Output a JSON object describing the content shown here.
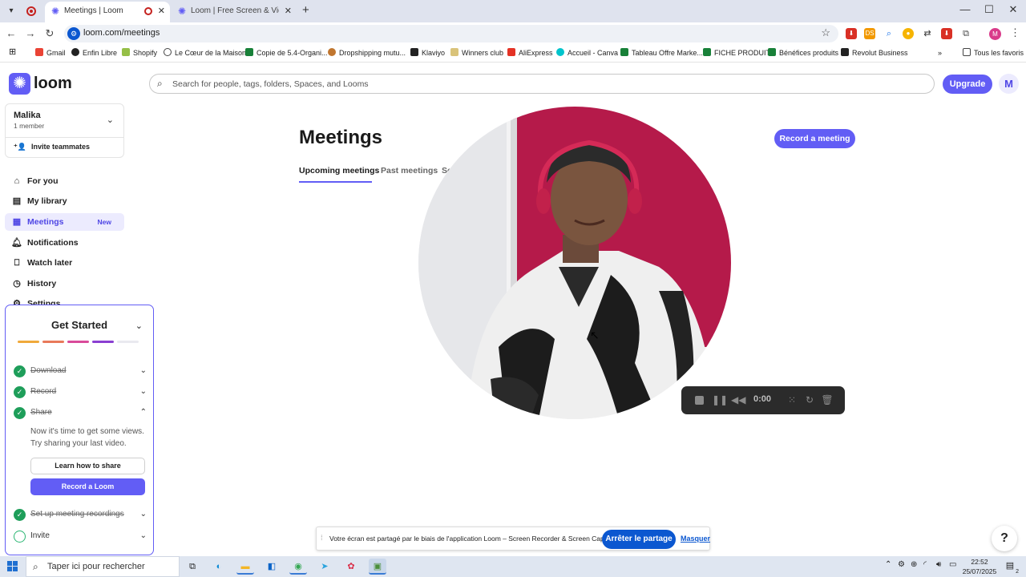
{
  "browser": {
    "tabs": [
      {
        "label": "Meetings | Loom",
        "active": true
      },
      {
        "label": "Loom | Free Screen & Video Re",
        "active": false
      }
    ],
    "url": "loom.com/meetings",
    "bookmarks": [
      {
        "label": "Gmail",
        "color": "#ea4335"
      },
      {
        "label": "Enfin Libre",
        "color": "#222222"
      },
      {
        "label": "Shopify",
        "color": "#95bf47"
      },
      {
        "label": "Le Cœur de la Maison",
        "color": "#444444"
      },
      {
        "label": "Copie de 5.4-Organi...",
        "color": "#188038"
      },
      {
        "label": "Dropshipping mutu...",
        "color": "#c0762f"
      },
      {
        "label": "Klaviyo",
        "color": "#222222"
      },
      {
        "label": "Winners club",
        "color": "#d9c37a"
      },
      {
        "label": "AliExpress",
        "color": "#e43225"
      },
      {
        "label": "Accueil - Canva",
        "color": "#00c4cc"
      },
      {
        "label": "Tableau Offre Marke...",
        "color": "#188038"
      },
      {
        "label": "FICHE PRODUIT",
        "color": "#188038"
      },
      {
        "label": "Bénéfices produits",
        "color": "#188038"
      },
      {
        "label": "Revolut Business",
        "color": "#222222"
      }
    ],
    "all_bookmarks": "Tous les favoris",
    "profile_initial": "M"
  },
  "loom": {
    "brand": "loom",
    "accent": "#625df5",
    "workspace": {
      "name": "Malika",
      "members": "1 member",
      "invite": "Invite teammates"
    },
    "nav": [
      {
        "label": "For you",
        "icon": "home-icon",
        "active": false,
        "badge": ""
      },
      {
        "label": "My library",
        "icon": "library-icon",
        "active": false,
        "badge": ""
      },
      {
        "label": "Meetings",
        "icon": "calendar-icon",
        "active": true,
        "badge": "New"
      },
      {
        "label": "Notifications",
        "icon": "bell-icon",
        "active": false,
        "badge": ""
      },
      {
        "label": "Watch later",
        "icon": "bookmark-icon",
        "active": false,
        "badge": ""
      },
      {
        "label": "History",
        "icon": "clock-icon",
        "active": false,
        "badge": ""
      },
      {
        "label": "Settings",
        "icon": "gear-icon",
        "active": false,
        "badge": ""
      }
    ],
    "get_started": {
      "title": "Get Started",
      "progress_colors": [
        "#f0a93b",
        "#e8795a",
        "#d94a9a",
        "#8a3fd1",
        "#e9e9ef"
      ],
      "steps": [
        {
          "label": "Download",
          "done": true
        },
        {
          "label": "Record",
          "done": true
        },
        {
          "label": "Share",
          "done": true
        },
        {
          "label": "Set up meeting recordings",
          "done": true
        },
        {
          "label": "Invite",
          "done": false
        }
      ],
      "share_text": "Now it's time to get some views. Try sharing your last video.",
      "learn_button": "Learn how to share",
      "record_button": "Record a Loom"
    },
    "search_placeholder": "Search for people, tags, folders, Spaces, and Looms",
    "upgrade": "Upgrade",
    "avatar_initial": "M",
    "page_title": "Meetings",
    "record_meeting": "Record a meeting",
    "tabs": [
      "Upcoming meetings",
      "Past meetings",
      "Se"
    ]
  },
  "recorder": {
    "timer": "0:00"
  },
  "share_notification": {
    "message": "Votre écran est partagé par le biais de l'application Loom – Screen Recorder & Screen Capture.",
    "stop": "Arrêter le partage",
    "hide": "Masquer"
  },
  "help": "?",
  "taskbar": {
    "search_placeholder": "Taper ici pour rechercher",
    "time": "22:52",
    "date": "25/07/2025",
    "notifications": "2"
  }
}
